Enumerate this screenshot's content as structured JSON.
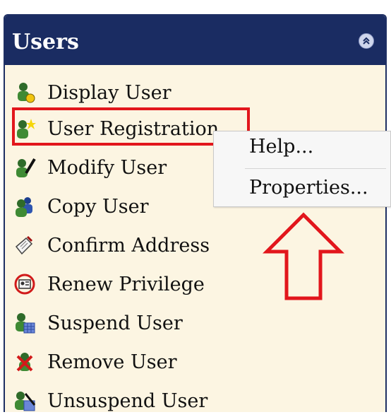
{
  "panel": {
    "title": "Users",
    "collapse_icon": "double-chevron-up-icon",
    "header_color": "#1a2c62",
    "background_color": "#fcf5e2"
  },
  "items": [
    {
      "label": "Display User",
      "icon": "user-display-icon"
    },
    {
      "label": "User Registration",
      "icon": "user-registration-icon"
    },
    {
      "label": "Modify User",
      "icon": "user-modify-icon"
    },
    {
      "label": "Copy User",
      "icon": "user-copy-icon"
    },
    {
      "label": "Confirm Address",
      "icon": "confirm-address-icon"
    },
    {
      "label": "Renew Privilege",
      "icon": "renew-privilege-icon"
    },
    {
      "label": "Suspend User",
      "icon": "user-suspend-icon"
    },
    {
      "label": "Remove User",
      "icon": "user-remove-icon"
    },
    {
      "label": "Unsuspend User",
      "icon": "user-unsuspend-icon"
    }
  ],
  "context_menu": {
    "items": [
      "Help...",
      "Properties..."
    ]
  },
  "annotations": {
    "highlight_color": "#e2161c",
    "arrow_icon": "up-arrow-outline-icon"
  }
}
